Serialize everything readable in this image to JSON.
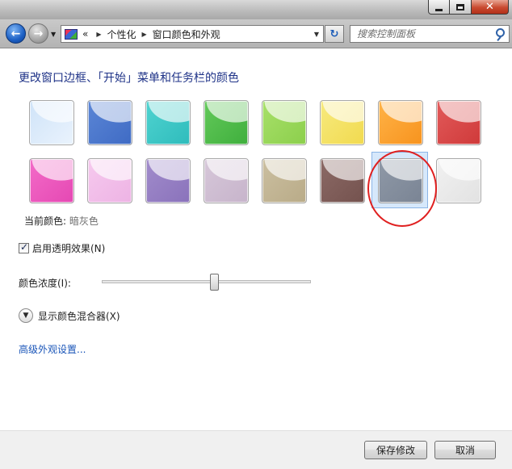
{
  "window": {
    "minimize_icon": "minimize-icon",
    "maximize_icon": "maximize-icon",
    "close_icon": "close-icon"
  },
  "nav": {
    "back_icon": "back-arrow-icon",
    "forward_icon": "forward-arrow-icon",
    "address_prefix": "«",
    "breadcrumb": [
      "个性化",
      "窗口颜色和外观"
    ],
    "search_placeholder": "搜索控制面板"
  },
  "main": {
    "title": "更改窗口边框、「开始」菜单和任务栏的颜色",
    "swatches": [
      {
        "color": "#cfe3f8",
        "dark": "#eaf3fd"
      },
      {
        "color": "#5b86d6",
        "dark": "#3f6bc4"
      },
      {
        "color": "#4fd3d0",
        "dark": "#2fbcbc"
      },
      {
        "color": "#63c95a",
        "dark": "#3faf3d"
      },
      {
        "color": "#a8e06a",
        "dark": "#8ccf4c"
      },
      {
        "color": "#f7ea7e",
        "dark": "#f1da4f"
      },
      {
        "color": "#ffb347",
        "dark": "#f7931e"
      },
      {
        "color": "#e25a5a",
        "dark": "#cf3a3a"
      },
      {
        "color": "#f36bc8",
        "dark": "#e548b3"
      },
      {
        "color": "#f6c9ee",
        "dark": "#edb3e4"
      },
      {
        "color": "#a18ccb",
        "dark": "#8a72bb"
      },
      {
        "color": "#d6c7d9",
        "dark": "#c7b4cb"
      },
      {
        "color": "#cbbfa0",
        "dark": "#b9ab88"
      },
      {
        "color": "#8c6a66",
        "dark": "#74524e"
      },
      {
        "color": "#8f99a7",
        "dark": "#7a8494",
        "selected": true
      },
      {
        "color": "#f1f1f1",
        "dark": "#e2e2e2"
      }
    ],
    "current_color_label": "当前颜色:",
    "current_color_value": "暗灰色",
    "transparency_label": "启用透明效果(N)",
    "transparency_checked": true,
    "intensity_label": "颜色浓度(I):",
    "intensity_level": 0.54,
    "mixer_label": "显示颜色混合器(X)",
    "advanced_link": "高级外观设置..."
  },
  "footer": {
    "save_label": "保存修改",
    "cancel_label": "取消"
  }
}
